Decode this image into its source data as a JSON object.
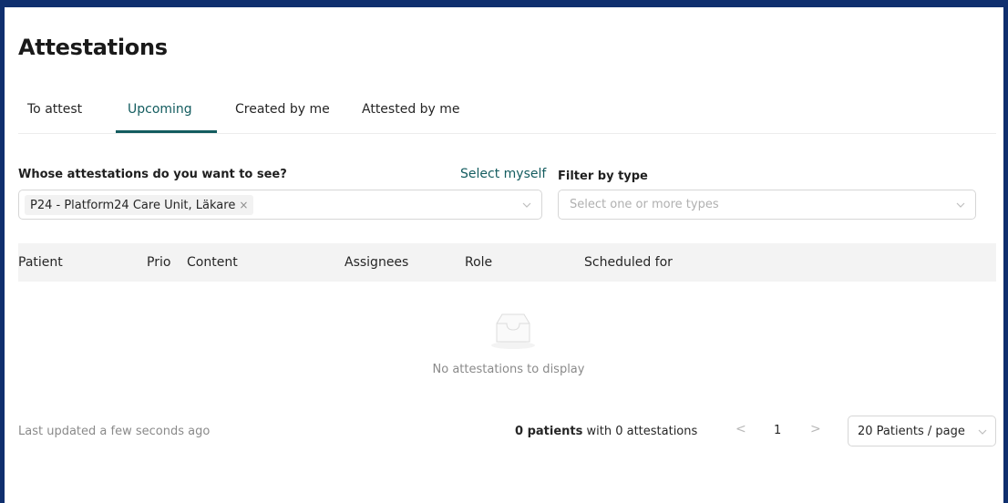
{
  "page": {
    "title": "Attestations"
  },
  "tabs": [
    {
      "label": "To attest",
      "active": false
    },
    {
      "label": "Upcoming",
      "active": true
    },
    {
      "label": "Created by me",
      "active": false
    },
    {
      "label": "Attested by me",
      "active": false
    }
  ],
  "filters": {
    "whose_label": "Whose attestations do you want to see?",
    "select_myself": "Select myself",
    "whose_selected_tag": "P24 - Platform24 Care Unit, Läkare",
    "tag_close": "×",
    "type_label": "Filter by type",
    "type_placeholder": "Select one or more types"
  },
  "table": {
    "columns": [
      "Patient",
      "Prio",
      "Content",
      "Assignees",
      "Role",
      "Scheduled for"
    ],
    "rows": [],
    "empty_text": "No attestations to display"
  },
  "footer": {
    "last_updated": "Last updated a few seconds ago",
    "patients_count": "0 patients",
    "attestations_text": "with 0 attestations",
    "prev": "<",
    "current_page": "1",
    "next": ">",
    "page_size": "20 Patients / page"
  },
  "colors": {
    "frame": "#0f2f6e",
    "accent": "#135c5f",
    "header_bg": "#f3f3f3"
  },
  "icons": {
    "empty": "inbox-icon",
    "dropdown": "chevron-down-icon"
  }
}
